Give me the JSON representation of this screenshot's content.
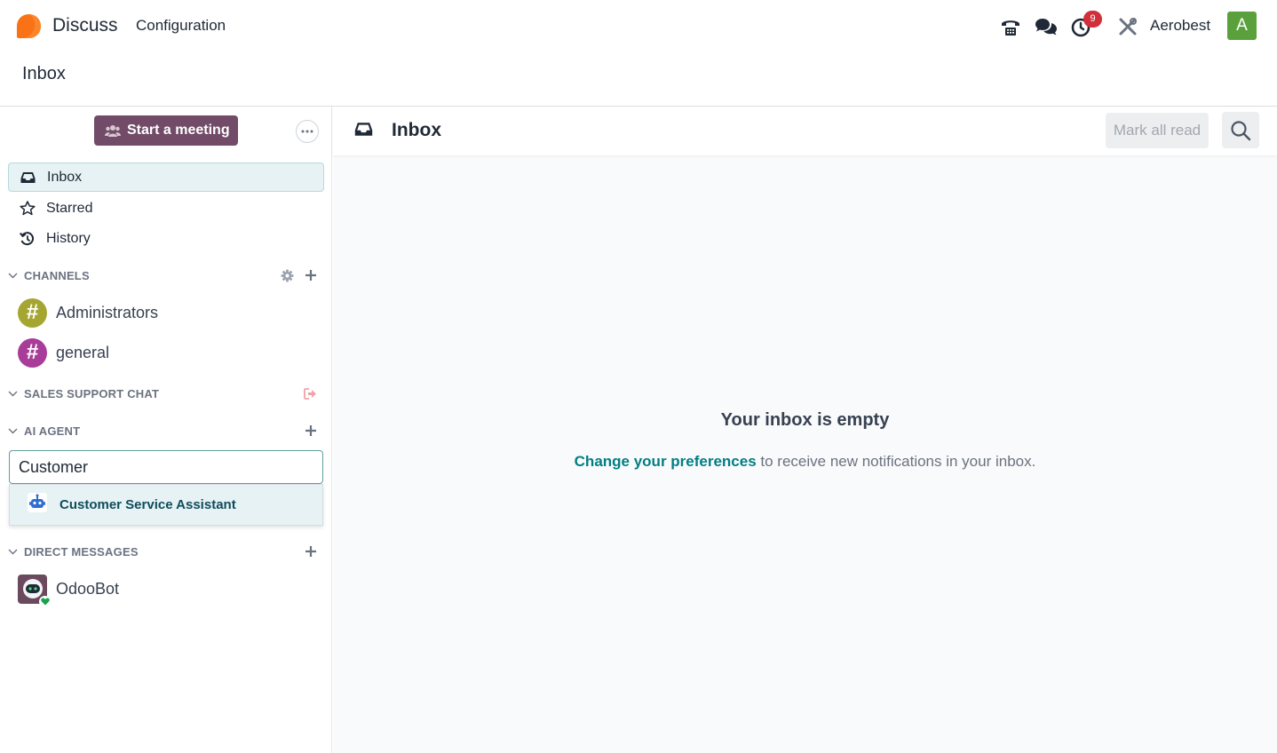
{
  "navbar": {
    "app_name": "Discuss",
    "menu_configuration": "Configuration",
    "activity_badge": "9",
    "company": "Aerobest",
    "user_initial": "A"
  },
  "breadcrumb": "Inbox",
  "sidebar": {
    "start_meeting": "Start a meeting",
    "mailboxes": {
      "inbox": "Inbox",
      "starred": "Starred",
      "history": "History"
    },
    "channels_header": "CHANNELS",
    "channels": [
      {
        "name": "Administrators",
        "color": "#a5a532"
      },
      {
        "name": "general",
        "color": "#a83c98"
      }
    ],
    "sales_support_header": "SALES SUPPORT CHAT",
    "ai_agent_header": "AI AGENT",
    "ai_search": {
      "value": "Customer",
      "suggestion": "Customer Service Assistant"
    },
    "direct_messages_header": "DIRECT MESSAGES",
    "direct_messages": [
      {
        "name": "OdooBot",
        "status": "online"
      }
    ]
  },
  "main": {
    "title": "Inbox",
    "mark_all_read": "Mark all read",
    "empty_title": "Your inbox is empty",
    "empty_link": "Change your preferences",
    "empty_text": " to receive new notifications in your inbox."
  },
  "colors": {
    "brand": "#714b67",
    "link": "#017e84",
    "badge": "#d12f3a",
    "active_bg": "#e6f2f3",
    "avatar": "#5aa13e"
  }
}
